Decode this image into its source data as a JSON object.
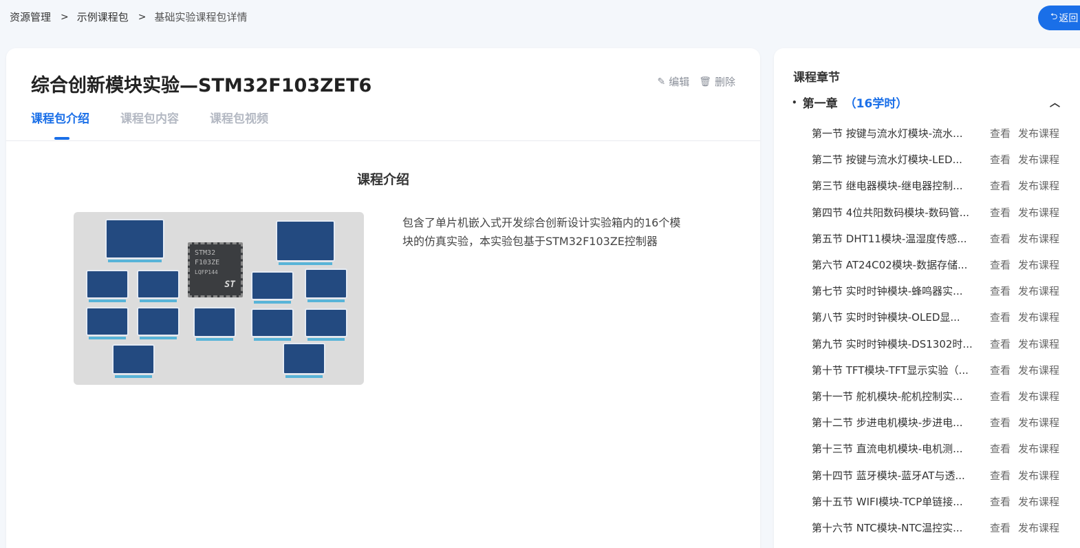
{
  "breadcrumb": {
    "items": [
      "资源管理",
      "示例课程包",
      "基础实验课程包详情"
    ],
    "separator": ">"
  },
  "back_button": {
    "label": "返回",
    "icon": "return-icon"
  },
  "course": {
    "title": "综合创新模块实验—STM32F103ZET6",
    "actions": {
      "edit": "编辑",
      "delete": "删除"
    },
    "tabs": [
      "课程包介绍",
      "课程包内容",
      "课程包视频"
    ],
    "active_tab": 0,
    "intro_title": "课程介绍",
    "description": "包含了单片机嵌入式开发综合创新设计实验箱内的16个模块的仿真实验，本实验包基于STM32F103ZE控制器",
    "image": {
      "chip_text_line1": "STM32",
      "chip_text_line2": "F103ZE",
      "chip_text_line3": "LQFP144",
      "chip_logo": "ST"
    }
  },
  "sidebar": {
    "title": "课程章节",
    "chapter": {
      "name": "第一章",
      "hours": "（16学时）",
      "expanded": true
    },
    "lessons": [
      {
        "name": "第一节 按键与流水灯模块-流水..."
      },
      {
        "name": "第二节 按键与流水灯模块-LED..."
      },
      {
        "name": "第三节 继电器模块-继电器控制..."
      },
      {
        "name": "第四节 4位共阳数码模块-数码管..."
      },
      {
        "name": "第五节 DHT11模块-温湿度传感..."
      },
      {
        "name": "第六节 AT24C02模块-数据存储..."
      },
      {
        "name": "第七节 实时时钟模块-蜂鸣器实..."
      },
      {
        "name": "第八节 实时时钟模块-OLED显..."
      },
      {
        "name": "第九节 实时时钟模块-DS1302时..."
      },
      {
        "name": "第十节 TFT模块-TFT显示实验（..."
      },
      {
        "name": "第十一节 舵机模块-舵机控制实..."
      },
      {
        "name": "第十二节 步进电机模块-步进电..."
      },
      {
        "name": "第十三节 直流电机模块-电机测..."
      },
      {
        "name": "第十四节 蓝牙模块-蓝牙AT与透..."
      },
      {
        "name": "第十五节 WIFI模块-TCP单链接..."
      },
      {
        "name": "第十六节 NTC模块-NTC温控实..."
      }
    ],
    "view_label": "查看",
    "publish_label": "发布课程"
  },
  "colors": {
    "accent": "#1a6fe8",
    "board": "#234a80",
    "background": "#f4f7fb"
  }
}
